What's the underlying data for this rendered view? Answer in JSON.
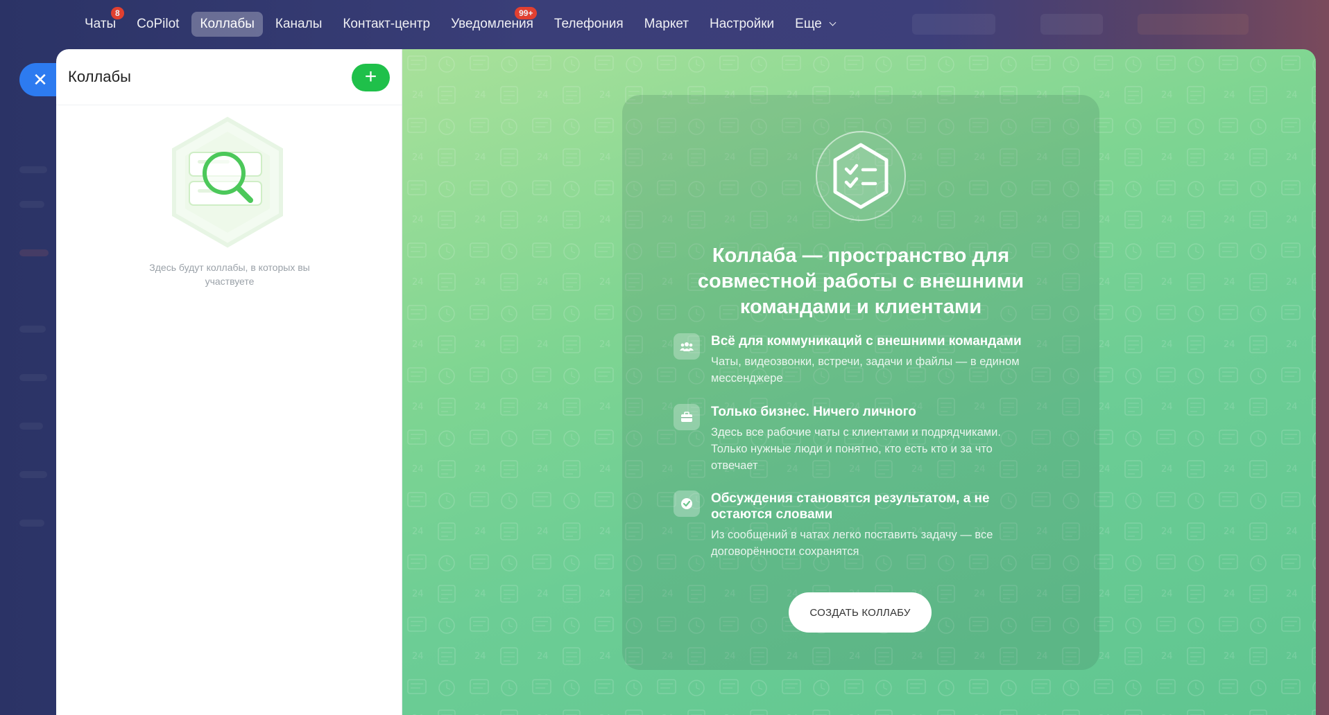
{
  "nav": {
    "items": [
      {
        "label": "Чаты",
        "badge": "8",
        "active": false
      },
      {
        "label": "CoPilot",
        "badge": "",
        "active": false
      },
      {
        "label": "Коллабы",
        "badge": "",
        "active": true
      },
      {
        "label": "Каналы",
        "badge": "",
        "active": false
      },
      {
        "label": "Контакт-центр",
        "badge": "",
        "active": false
      },
      {
        "label": "Уведомления",
        "badge": "99+",
        "active": false
      },
      {
        "label": "Телефония",
        "badge": "",
        "active": false
      },
      {
        "label": "Маркет",
        "badge": "",
        "active": false
      },
      {
        "label": "Настройки",
        "badge": "",
        "active": false
      },
      {
        "label": "Еще",
        "badge": "",
        "active": false
      }
    ]
  },
  "panel": {
    "title": "Коллабы",
    "add_icon": "plus-icon",
    "empty_text": "Здесь будут коллабы, в которых вы участвуете"
  },
  "promo": {
    "title": "Коллаба — пространство для совместной работы с внешними командами и клиентами",
    "features": [
      {
        "icon": "people-icon",
        "title": "Всё для коммуникаций с внешними командами",
        "desc": "Чаты, видеозвонки, встречи, задачи и файлы — в едином мессенджере"
      },
      {
        "icon": "briefcase-icon",
        "title": "Только бизнес. Ничего личного",
        "desc": "Здесь все рабочие чаты с клиентами и подрядчиками. Только нужные люди и понятно, кто есть кто и за что отвечает"
      },
      {
        "icon": "checkmark-icon",
        "title": "Обсуждения становятся результатом, а не остаются словами",
        "desc": "Из сообщений в чатах легко поставить задачу — все договорённости сохранятся"
      }
    ],
    "button_label": "СОЗДАТЬ КОЛЛАБУ"
  },
  "colors": {
    "accent_green": "#1fc04a",
    "close_blue": "#2d7bf0",
    "badge_red": "#f0412c"
  }
}
